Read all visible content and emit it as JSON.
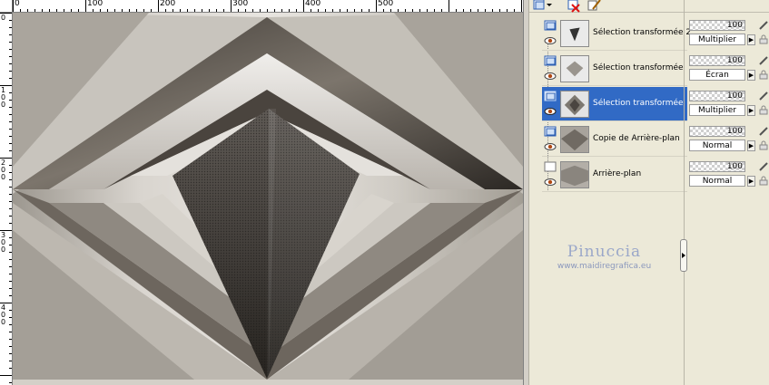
{
  "ruler": {
    "top_labels": [
      "0",
      "100",
      "200",
      "300",
      "400",
      "500"
    ],
    "left_labels": [
      "0",
      "100",
      "200",
      "300",
      "400"
    ]
  },
  "toolbar": {
    "icons": [
      "new-layer-icon",
      "dropdown-arrow-icon",
      "delete-layer-icon",
      "edit-icon"
    ]
  },
  "layers": [
    {
      "name": "Sélection transformée 2",
      "type": "raster",
      "opacity": "100",
      "blend": "Multiplier",
      "selected": false
    },
    {
      "name": "Sélection transformée",
      "type": "raster",
      "opacity": "100",
      "blend": "Écran",
      "selected": false
    },
    {
      "name": "Sélection transformée",
      "type": "raster",
      "opacity": "100",
      "blend": "Multiplier",
      "selected": true
    },
    {
      "name": "Copie de Arrière-plan",
      "type": "raster",
      "opacity": "100",
      "blend": "Normal",
      "selected": false
    },
    {
      "name": "Arrière-plan",
      "type": "background",
      "opacity": "100",
      "blend": "Normal",
      "selected": false
    }
  ],
  "watermark": {
    "name": "Pinuccia",
    "url": "www.maidiregrafica.eu"
  },
  "colors": {
    "selection": "#316ac5",
    "panel": "#ece9d8"
  }
}
